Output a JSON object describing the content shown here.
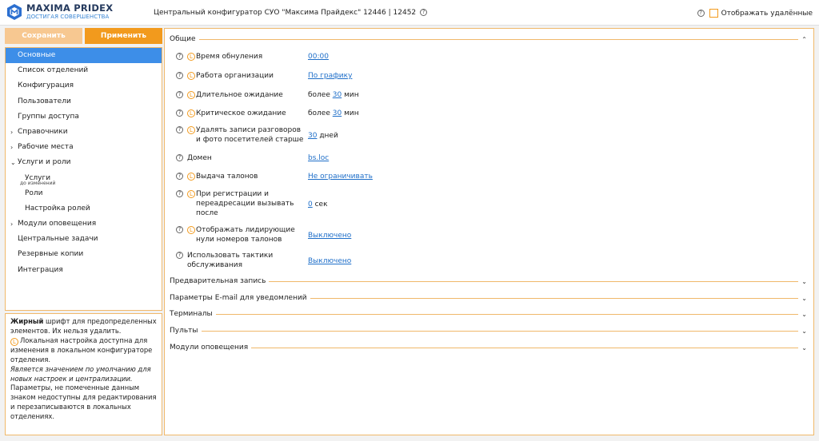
{
  "header": {
    "logo_name": "MAXIMA PRIDEX",
    "logo_slogan": "ДОСТИГАЯ СОВЕРШЕНСТВА",
    "title": "Центральный конфигуратор СУО \"Максима Прайдекс\" 12446 | 12452",
    "show_deleted_label": "Отображать удалённые"
  },
  "toolbar": {
    "save_label": "Сохранить",
    "apply_label": "Применить"
  },
  "nav": {
    "items": [
      {
        "label": "Основные"
      },
      {
        "label": "Список отделений"
      },
      {
        "label": "Конфигурация"
      },
      {
        "label": "Пользователи"
      },
      {
        "label": "Группы доступа"
      },
      {
        "label": "Справочники"
      },
      {
        "label": "Рабочие места"
      },
      {
        "label": "Услуги и роли"
      },
      {
        "label": "Услуги",
        "tiny": "до изменений"
      },
      {
        "label": "Роли"
      },
      {
        "label": "Настройка ролей"
      },
      {
        "label": "Модули оповещения"
      },
      {
        "label": "Центральные задачи"
      },
      {
        "label": "Резервные копии"
      },
      {
        "label": "Интеграция"
      }
    ]
  },
  "legend": {
    "bold_word": "Жирный",
    "p1_rest": " шрифт для предопределенных элементов. Их нельзя удалить.",
    "badge": "L",
    "p2": "Локальная настройка доступна для изменения в локальном конфигураторе отделения.",
    "p3_italic": "Является значением по умолчанию для новых настроек и централизации.",
    "p4": "Параметры, не помеченные данным знаком недоступны для редактирования и перезаписываются в локальных отделениях."
  },
  "main": {
    "general_title": "Общие",
    "settings": [
      {
        "label": "Время обнуления",
        "prefix": "",
        "link": "00:00",
        "suffix": ""
      },
      {
        "label": "Работа организации",
        "prefix": "",
        "link": "По графику",
        "suffix": ""
      },
      {
        "label": "Длительное ожидание",
        "prefix": "более ",
        "link": "30",
        "suffix": " мин"
      },
      {
        "label": "Критическое ожидание",
        "prefix": "более ",
        "link": "30",
        "suffix": " мин"
      },
      {
        "label": "Удалять записи разговоров и фото посетителей старше",
        "prefix": "",
        "link": "30",
        "suffix": " дней"
      },
      {
        "label": "Домен",
        "prefix": "",
        "link": "bs.loc",
        "suffix": ""
      },
      {
        "label": "Выдача талонов",
        "prefix": "",
        "link": "Не ограничивать",
        "suffix": ""
      },
      {
        "label": "При регистрации и переадресации вызывать после",
        "prefix": "",
        "link": "0",
        "suffix": " сек"
      },
      {
        "label": "Отображать лидирующие нули номеров талонов",
        "prefix": "",
        "link": "Выключено",
        "suffix": ""
      },
      {
        "label": "Использовать тактики обслуживания",
        "prefix": "",
        "link": "Выключено",
        "suffix": ""
      }
    ],
    "sections": [
      {
        "title": "Предварительная запись"
      },
      {
        "title": "Параметры E-mail для уведомлений"
      },
      {
        "title": "Терминалы"
      },
      {
        "title": "Пульты"
      },
      {
        "title": "Модули оповещения"
      }
    ]
  },
  "colors": {
    "accent": "#f29a1d",
    "accent_light": "#f7c891",
    "active": "#3d8ee8",
    "link": "#1f6fc9",
    "border": "#f0b86a"
  },
  "icons": [
    "help-icon",
    "local-setting-icon",
    "chevron-right-icon",
    "chevron-down-icon",
    "chevron-up-icon"
  ]
}
